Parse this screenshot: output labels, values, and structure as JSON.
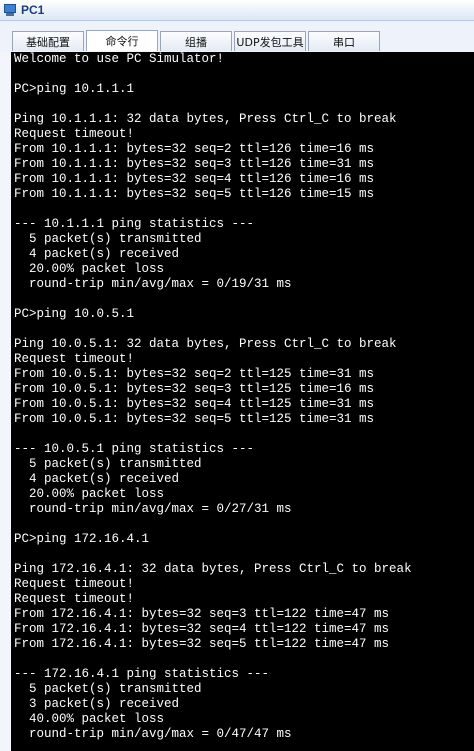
{
  "window": {
    "title": "PC1"
  },
  "tabs": [
    {
      "label": "基础配置"
    },
    {
      "label": "命令行"
    },
    {
      "label": "组播"
    },
    {
      "label": "UDP发包工具"
    },
    {
      "label": "串口"
    }
  ],
  "active_tab": "命令行",
  "console": {
    "lines": [
      "Welcome to use PC Simulator!",
      "",
      "PC>ping 10.1.1.1",
      "",
      "Ping 10.1.1.1: 32 data bytes, Press Ctrl_C to break",
      "Request timeout!",
      "From 10.1.1.1: bytes=32 seq=2 ttl=126 time=16 ms",
      "From 10.1.1.1: bytes=32 seq=3 ttl=126 time=31 ms",
      "From 10.1.1.1: bytes=32 seq=4 ttl=126 time=16 ms",
      "From 10.1.1.1: bytes=32 seq=5 ttl=126 time=15 ms",
      "",
      "--- 10.1.1.1 ping statistics ---",
      "  5 packet(s) transmitted",
      "  4 packet(s) received",
      "  20.00% packet loss",
      "  round-trip min/avg/max = 0/19/31 ms",
      "",
      "PC>ping 10.0.5.1",
      "",
      "Ping 10.0.5.1: 32 data bytes, Press Ctrl_C to break",
      "Request timeout!",
      "From 10.0.5.1: bytes=32 seq=2 ttl=125 time=31 ms",
      "From 10.0.5.1: bytes=32 seq=3 ttl=125 time=16 ms",
      "From 10.0.5.1: bytes=32 seq=4 ttl=125 time=31 ms",
      "From 10.0.5.1: bytes=32 seq=5 ttl=125 time=31 ms",
      "",
      "--- 10.0.5.1 ping statistics ---",
      "  5 packet(s) transmitted",
      "  4 packet(s) received",
      "  20.00% packet loss",
      "  round-trip min/avg/max = 0/27/31 ms",
      "",
      "PC>ping 172.16.4.1",
      "",
      "Ping 172.16.4.1: 32 data bytes, Press Ctrl_C to break",
      "Request timeout!",
      "Request timeout!",
      "From 172.16.4.1: bytes=32 seq=3 ttl=122 time=47 ms",
      "From 172.16.4.1: bytes=32 seq=4 ttl=122 time=47 ms",
      "From 172.16.4.1: bytes=32 seq=5 ttl=122 time=47 ms",
      "",
      "--- 172.16.4.1 ping statistics ---",
      "  5 packet(s) transmitted",
      "  3 packet(s) received",
      "  40.00% packet loss",
      "  round-trip min/avg/max = 0/47/47 ms"
    ]
  },
  "colors": {
    "console_bg": "#000000",
    "console_fg": "#ffffff",
    "title_fg": "#1b3f7a"
  },
  "icons": {
    "app": "pc-monitor-icon"
  }
}
